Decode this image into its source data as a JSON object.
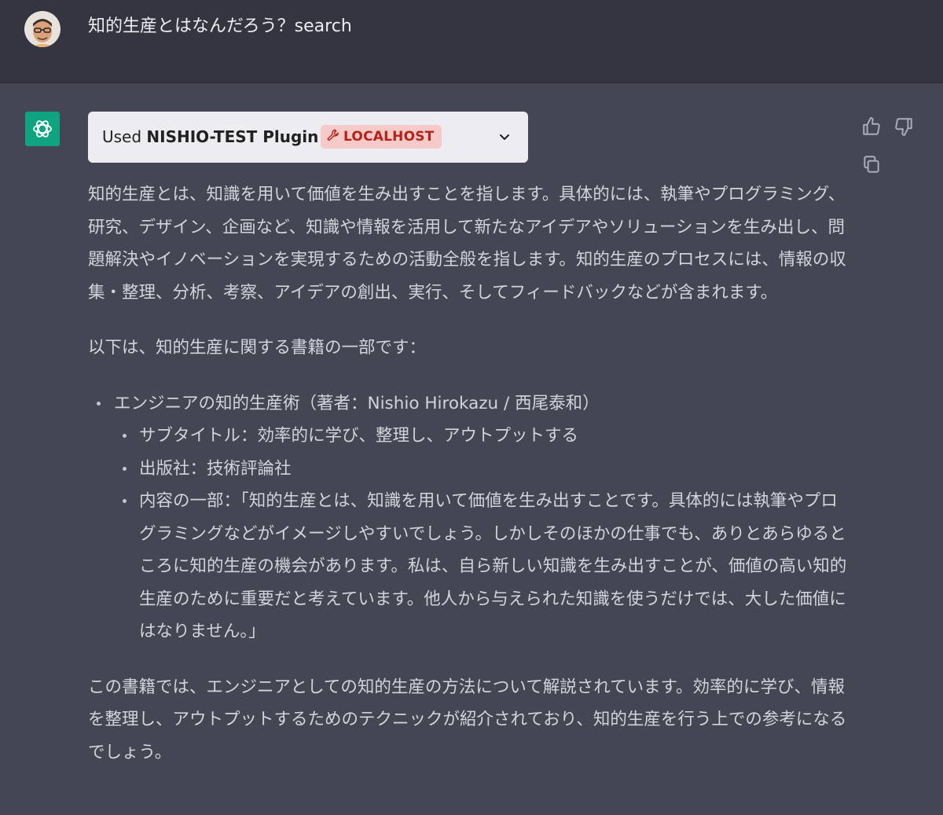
{
  "user_message": {
    "text": "知的生産とはなんだろう？search"
  },
  "plugin": {
    "used_prefix": "Used",
    "plugin_name": "NISHIO-TEST Plugin",
    "badge": "LOCALHOST",
    "badge_icon": "wrench-icon",
    "expand_icon": "chevron-down-icon"
  },
  "actions": {
    "thumbs_up_icon": "thumbs-up-icon",
    "thumbs_down_icon": "thumbs-down-icon",
    "copy_icon": "copy-icon"
  },
  "response": {
    "paragraph1": "知的生産とは、知識を用いて価値を生み出すことを指します。具体的には、執筆やプログラミング、研究、デザイン、企画など、知識や情報を活用して新たなアイデアやソリューションを生み出し、問題解決やイノベーションを実現するための活動全般を指します。知的生産のプロセスには、情報の収集・整理、分析、考察、アイデアの創出、実行、そしてフィードバックなどが含まれます。",
    "paragraph2": "以下は、知的生産に関する書籍の一部です：",
    "book": {
      "title": "エンジニアの知的生産術（著者：Nishio Hirokazu / 西尾泰和）",
      "details": [
        "サブタイトル：効率的に学び、整理し、アウトプットする",
        "出版社：技術評論社",
        "内容の一部：「知的生産とは、知識を用いて価値を生み出すことです。具体的には執筆やプログラミングなどがイメージしやすいでしょう。しかしそのほかの仕事でも、ありとあらゆるところに知的生産の機会があります。私は、自ら新しい知識を生み出すことが、価値の高い知的生産のために重要だと考えています。他人から与えられた知識を使うだけでは、大した価値にはなりません。」"
      ]
    },
    "paragraph3": "この書籍では、エンジニアとしての知的生産の方法について解説されています。効率的に学び、情報を整理し、アウトプットするためのテクニックが紹介されており、知的生産を行う上での参考になるでしょう。"
  },
  "colors": {
    "user_bg": "#343541",
    "assistant_bg": "#444654",
    "brand": "#10a37f",
    "badge_bg": "#f7caca",
    "badge_text": "#b42318"
  }
}
